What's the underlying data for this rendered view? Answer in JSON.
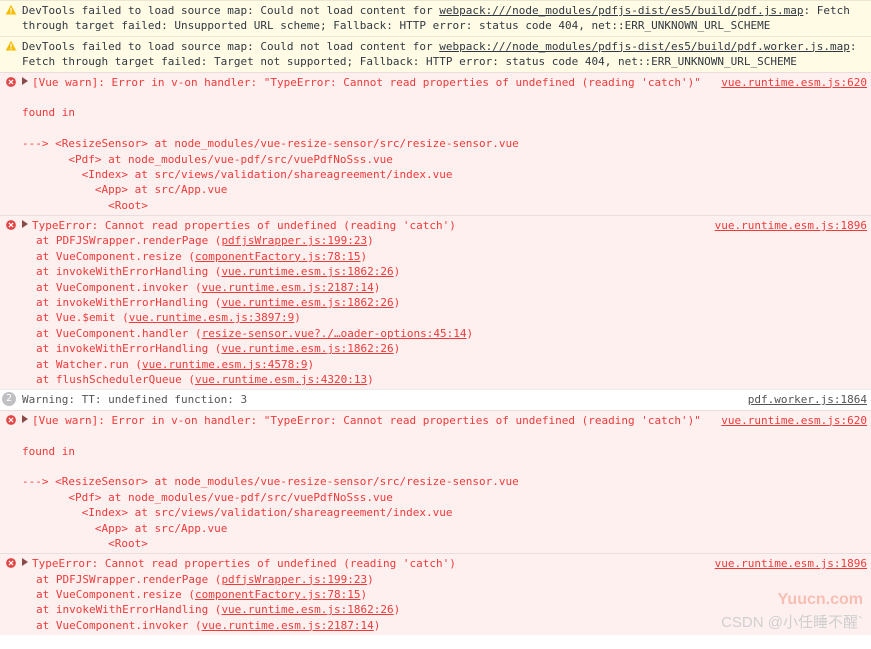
{
  "rows": [
    {
      "type": "warn",
      "msgPre": "DevTools failed to load source map: Could not load content for ",
      "link": "webpack:///node_modules/pdfjs-dist/es5/build/pdf.js.map",
      "msgPost": ": Fetch through target failed: Unsupported URL scheme; Fallback: HTTP error: status code 404, net::ERR_UNKNOWN_URL_SCHEME",
      "src": ""
    },
    {
      "type": "warn",
      "msgPre": "DevTools failed to load source map: Could not load content for ",
      "link": "webpack:///node_modules/pdfjs-dist/es5/build/pdf.worker.js.map",
      "msgPost": ": Fetch through target failed: Target not supported; Fallback: HTTP error: status code 404, net::ERR_UNKNOWN_URL_SCHEME",
      "src": ""
    },
    {
      "type": "err",
      "expand": true,
      "msg": "[Vue warn]: Error in v-on handler: \"TypeError: Cannot read properties of undefined (reading 'catch')\"\n\nfound in\n\n---> <ResizeSensor> at node_modules/vue-resize-sensor/src/resize-sensor.vue\n       <Pdf> at node_modules/vue-pdf/src/vuePdfNoSss.vue\n         <Index> at src/views/validation/shareagreement/index.vue\n           <App> at src/App.vue\n             <Root>",
      "src": "vue.runtime.esm.js:620"
    },
    {
      "type": "err",
      "expand": true,
      "head": "TypeError: Cannot read properties of undefined (reading 'catch')",
      "stack": [
        {
          "pre": "at PDFJSWrapper.renderPage (",
          "link": "pdfjsWrapper.js:199:23",
          "post": ")"
        },
        {
          "pre": "at VueComponent.resize (",
          "link": "componentFactory.js:78:15",
          "post": ")"
        },
        {
          "pre": "at invokeWithErrorHandling (",
          "link": "vue.runtime.esm.js:1862:26",
          "post": ")"
        },
        {
          "pre": "at VueComponent.invoker (",
          "link": "vue.runtime.esm.js:2187:14",
          "post": ")"
        },
        {
          "pre": "at invokeWithErrorHandling (",
          "link": "vue.runtime.esm.js:1862:26",
          "post": ")"
        },
        {
          "pre": "at Vue.$emit (",
          "link": "vue.runtime.esm.js:3897:9",
          "post": ")"
        },
        {
          "pre": "at VueComponent.handler (",
          "link": "resize-sensor.vue?./…oader-options:45:14",
          "post": ")"
        },
        {
          "pre": "at invokeWithErrorHandling (",
          "link": "vue.runtime.esm.js:1862:26",
          "post": ")"
        },
        {
          "pre": "at Watcher.run (",
          "link": "vue.runtime.esm.js:4578:9",
          "post": ")"
        },
        {
          "pre": "at flushSchedulerQueue (",
          "link": "vue.runtime.esm.js:4320:13",
          "post": ")"
        }
      ],
      "src": "vue.runtime.esm.js:1896"
    },
    {
      "type": "info",
      "badge": "2",
      "msg": "Warning: TT: undefined function: 3",
      "src": "pdf.worker.js:1864"
    },
    {
      "type": "err",
      "expand": true,
      "msg": "[Vue warn]: Error in v-on handler: \"TypeError: Cannot read properties of undefined (reading 'catch')\"\n\nfound in\n\n---> <ResizeSensor> at node_modules/vue-resize-sensor/src/resize-sensor.vue\n       <Pdf> at node_modules/vue-pdf/src/vuePdfNoSss.vue\n         <Index> at src/views/validation/shareagreement/index.vue\n           <App> at src/App.vue\n             <Root>",
      "src": "vue.runtime.esm.js:620"
    },
    {
      "type": "err",
      "expand": true,
      "head": "TypeError: Cannot read properties of undefined (reading 'catch')",
      "stack": [
        {
          "pre": "at PDFJSWrapper.renderPage (",
          "link": "pdfjsWrapper.js:199:23",
          "post": ")"
        },
        {
          "pre": "at VueComponent.resize (",
          "link": "componentFactory.js:78:15",
          "post": ")"
        },
        {
          "pre": "at invokeWithErrorHandling (",
          "link": "vue.runtime.esm.js:1862:26",
          "post": ")"
        },
        {
          "pre": "at VueComponent.invoker (",
          "link": "vue.runtime.esm.js:2187:14",
          "post": ")"
        }
      ],
      "src": "vue.runtime.esm.js:1896"
    }
  ],
  "watermark1": "Yuucn.com",
  "watermark2": "CSDN @小任睡不醒`"
}
